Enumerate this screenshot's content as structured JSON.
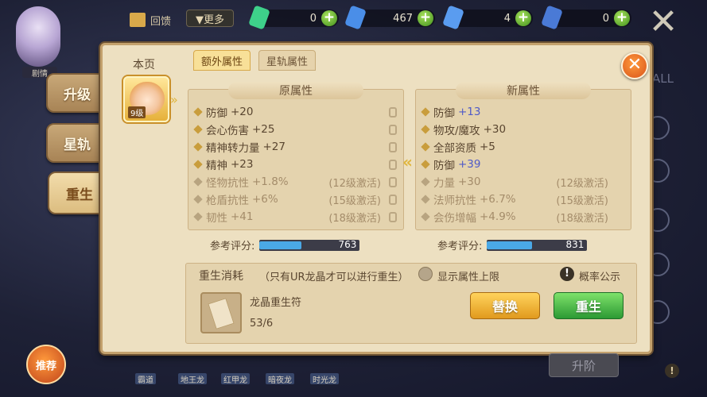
{
  "hud": {
    "avatar_label": "剧情",
    "gift_label": "回馈",
    "more_label": "▼更多",
    "resources": [
      {
        "value": "0",
        "color": "#3ed18a"
      },
      {
        "value": "467",
        "color": "#4a8ee8"
      },
      {
        "value": "4",
        "color": "#5a9cf0"
      },
      {
        "value": "0",
        "color": "#4a7ad6"
      }
    ],
    "close_label": "✕"
  },
  "side_tabs": [
    "升级",
    "星轨",
    "重生"
  ],
  "panel": {
    "close_label": "✕",
    "page_label": "本页",
    "hero_level": "9级",
    "tabs": [
      "额外属性",
      "星轨属性"
    ],
    "original": {
      "title": "原属性",
      "rows": [
        {
          "name": "防御",
          "value": "+20",
          "activation": "",
          "dim": false
        },
        {
          "name": "会心伤害",
          "value": "+25",
          "activation": "",
          "dim": false
        },
        {
          "name": "精神转力量",
          "value": "+27",
          "activation": "",
          "dim": false
        },
        {
          "name": "精神",
          "value": "+23",
          "activation": "",
          "dim": false
        },
        {
          "name": "怪物抗性",
          "value": "+1.8%",
          "activation": "(12级激活)",
          "dim": true
        },
        {
          "name": "枪盾抗性",
          "value": "+6%",
          "activation": "(15级激活)",
          "dim": true
        },
        {
          "name": "韧性",
          "value": "+41",
          "activation": "(18级激活)",
          "dim": true
        }
      ],
      "score_label": "参考评分:",
      "score_value": "763",
      "score_fill": 0.42
    },
    "new": {
      "title": "新属性",
      "rows": [
        {
          "name": "防御",
          "value": "+13",
          "activation": "",
          "dim": false,
          "blue": true
        },
        {
          "name": "物攻/魔攻",
          "value": "+30",
          "activation": "",
          "dim": false,
          "blue": false
        },
        {
          "name": "全部资质",
          "value": "+5",
          "activation": "",
          "dim": false,
          "blue": false
        },
        {
          "name": "防御",
          "value": "+39",
          "activation": "",
          "dim": false,
          "blue": true
        },
        {
          "name": "力量",
          "value": "+30",
          "activation": "(12级激活)",
          "dim": true,
          "blue": false
        },
        {
          "name": "法师抗性",
          "value": "+6.7%",
          "activation": "(15级激活)",
          "dim": true,
          "blue": false
        },
        {
          "name": "会伤增幅",
          "value": "+4.9%",
          "activation": "(18级激活)",
          "dim": true,
          "blue": false
        }
      ],
      "score_label": "参考评分:",
      "score_value": "831",
      "score_fill": 0.45
    },
    "cost": {
      "title": "重生消耗",
      "note": "（只有UR龙晶才可以进行重生）",
      "toggle_label": "显示属性上限",
      "prob_label": "概率公示",
      "item_name": "龙晶重生符",
      "item_count": "53/6",
      "replace_label": "替换",
      "rebirth_label": "重生"
    }
  },
  "bottom": {
    "recommend_label": "推荐",
    "tabs": [
      "霸道",
      "地王龙",
      "红甲龙",
      "暗夜龙",
      "时光龙"
    ],
    "upgrade_label": "升阶",
    "help_label": "!"
  },
  "right_partial_label": "ALL"
}
